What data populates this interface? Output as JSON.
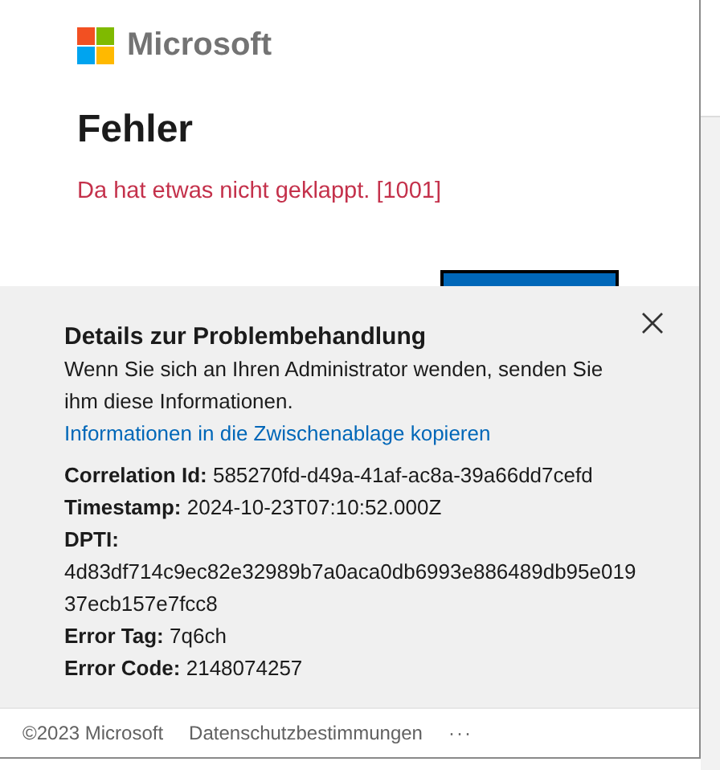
{
  "header": {
    "logo_text": "Microsoft"
  },
  "title": "Fehler",
  "error_message": "Da hat etwas nicht geklappt. [1001]",
  "details": {
    "title": "Details zur Problembehandlung",
    "description": "Wenn Sie sich an Ihren Administrator wenden, senden Sie ihm diese Informationen.",
    "copy_link": "Informationen in die Zwischenablage kopieren",
    "fields": [
      {
        "kind": "inline",
        "label": "Correlation Id:",
        "value": "585270fd-d49a-41af-ac8a-39a66dd7cefd"
      },
      {
        "kind": "inline",
        "label": "Timestamp:",
        "value": "2024-10-23T07:10:52.000Z"
      },
      {
        "kind": "block",
        "label": "DPTI:",
        "value": "4d83df714c9ec82e32989b7a0aca0db6993e886489db95e01937ecb157e7fcc8"
      },
      {
        "kind": "inline",
        "label": "Error Tag:",
        "value": "7q6ch"
      },
      {
        "kind": "inline",
        "label": "Error Code:",
        "value": "2148074257"
      }
    ]
  },
  "footer": {
    "copyright": "©2023 Microsoft",
    "links": [
      "Datenschutzbestimmungen"
    ],
    "more": "···"
  }
}
